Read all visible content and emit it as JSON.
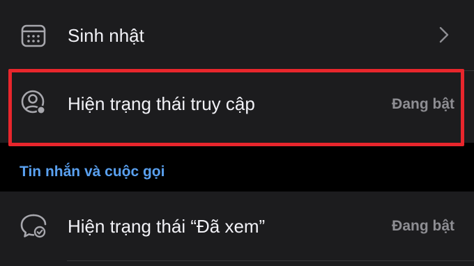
{
  "settings": {
    "rows": [
      {
        "label": "Sinh nhật",
        "icon": "calendar-icon"
      },
      {
        "label": "Hiện trạng thái truy cập",
        "value": "Đang bật",
        "icon": "user-status-icon"
      }
    ],
    "section_header": "Tin nhắn và cuộc gọi",
    "section_rows": [
      {
        "label": "Hiện trạng thái “Đã xem”",
        "value": "Đang bật",
        "icon": "seen-message-icon"
      }
    ]
  },
  "colors": {
    "background": "#000000",
    "card": "#1c1c1e",
    "text": "#f2f2f7",
    "secondary_text": "#8e8e93",
    "section_header": "#5aa1f0",
    "highlight": "#e8262c"
  }
}
